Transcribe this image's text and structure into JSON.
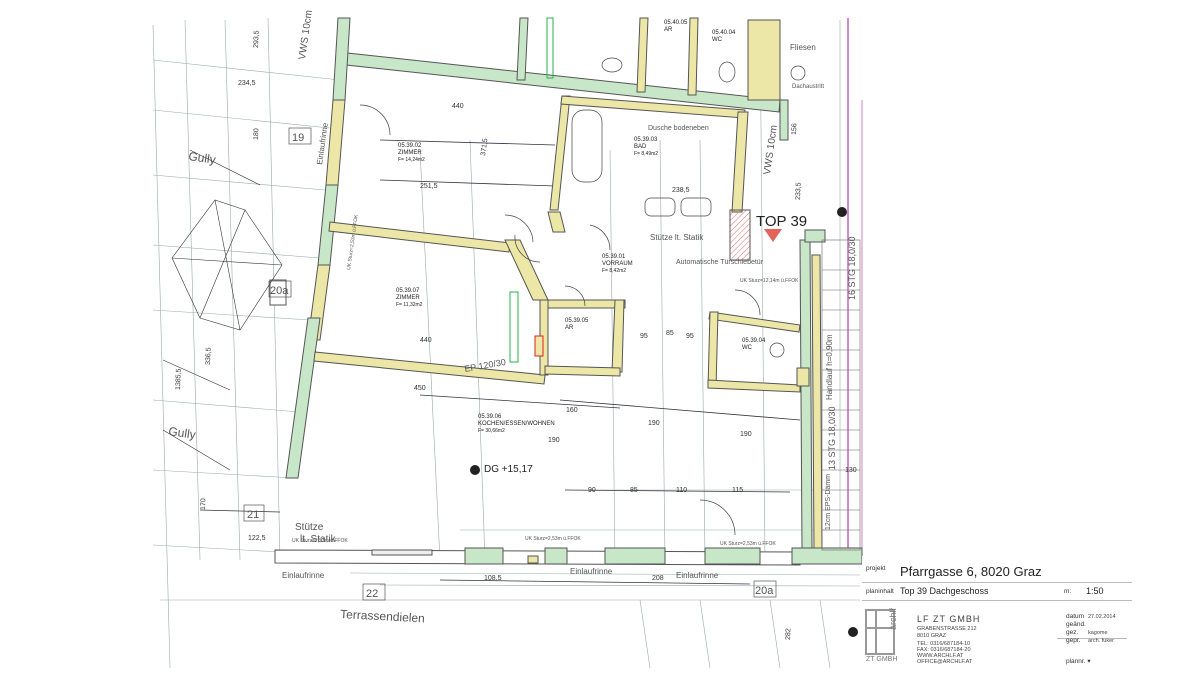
{
  "plan": {
    "top_label": "TOP 39",
    "dg_level": "DG +15,17",
    "rooms": [
      {
        "num": "05.39.02",
        "name": "ZIMMER",
        "area": "F= 14,24m2"
      },
      {
        "num": "05.39.03",
        "name": "BAD",
        "area": "F= 8,49m2"
      },
      {
        "num": "05.39.01",
        "name": "VORRAUM",
        "area": "F= 8,42m2"
      },
      {
        "num": "05.39.07",
        "name": "ZIMMER",
        "area": "F= 11,32m2"
      },
      {
        "num": "05.39.05",
        "name": "AR",
        "area": ""
      },
      {
        "num": "05.39.04",
        "name": "WC",
        "area": ""
      },
      {
        "num": "05.39.06",
        "name": "KOCHEN/ESSEN/WOHNEN",
        "area": "F= 30,66m2"
      },
      {
        "num": "05.40.05",
        "name": "AR",
        "area": ""
      },
      {
        "num": "05.40.04",
        "name": "WC",
        "area": ""
      }
    ],
    "labels": {
      "gully1": "Gully",
      "gully2": "Gully",
      "terrassendielen": "Terrassendielen",
      "einlaufrinne1": "Einlaufrinne",
      "einlaufrinne2": "Einlaufrinne",
      "einlaufrinne3": "Einlaufrinne",
      "einlaufrinne4": "Einlaufrinne",
      "stuetze": "Stütze",
      "statik": "lt. Statik",
      "tag19": "19",
      "tag20a": "20a",
      "tag21": "21",
      "tag22": "22",
      "tag20a_bottom": "20a",
      "vws_left": "VWS 10cm",
      "vws_right": "VWS 10cm",
      "stg13": "13 STG 18,0/30",
      "stg16": "16 STG 18,0/30",
      "handlauf": "Handlauf h=0,90m",
      "epsdaemm": "12cm EPS-Dämm",
      "dusche": "Dusche bodeneben",
      "stuetze_statik": "Stütze lt. Statik",
      "schiebetuer": "Automatische Türschiebetür",
      "fliesen": "Fliesen",
      "dachaustritt": "Dachaustritt",
      "ep120": "EP 120/30",
      "ukstuerz1": "UK Sturz=2,53m ü.FFOK",
      "ukstuerz2": "UK Sturz=2,53m ü.FFOK",
      "ukstuerz3": "UK Sturz=12,14m ü.FFOK",
      "ukstuerz4": "UK Sturz=2,53m ü.FFOK",
      "ukstuerz5": "UK Sturz=2,53m ü.FFOK",
      "dims": [
        "440",
        "371,5",
        "251,5",
        "238,5",
        "440",
        "190",
        "160",
        "190",
        "190",
        "90",
        "85",
        "110",
        "115",
        "108,5",
        "208",
        "122,5",
        "170",
        "1385,5",
        "336,5",
        "180",
        "293,5",
        "234,5",
        "156",
        "233,5",
        "95",
        "95",
        "450",
        "85",
        "130",
        "282"
      ]
    }
  },
  "title_block": {
    "projekt_label": "projekt",
    "projekt_value": "Pfarrgasse 6, 8020 Graz",
    "planinhalt_label": "planinhalt",
    "planinhalt_value": "Top 39 Dachgeschoss",
    "massstab_label": "m:",
    "massstab_value": "1:50",
    "datum_label": "datum",
    "datum_value": "27.02.2014",
    "geaend_label": "geänd.",
    "gez_label": "gez.",
    "gez_value": "kagome",
    "gepr_label": "gepr.",
    "gepr_value": "arch. fuker",
    "plannr_label": "plannr. ▾",
    "firm_name": "LF ZT GMBH",
    "firm_street": "GRABENSTRASSE 212",
    "firm_city": "8010     GRAZ",
    "firm_tel": "TEL:    0316/687184-10",
    "firm_fax": "FAX:    0316/687184-20",
    "firm_web": "WWW.ARCHLF.AT",
    "firm_mail": "OFFICE@ARCHLF.AT",
    "logo_text_side": "archlf",
    "logo_text_bottom": "ZT GMBH"
  },
  "colors": {
    "wall_green": "#c8e6c8",
    "wall_yellow": "#ece7a6",
    "wall_stroke": "#555555",
    "marker_red": "#e4645c",
    "line_magenta": "#c064c0",
    "accent_green": "#27b04b"
  }
}
